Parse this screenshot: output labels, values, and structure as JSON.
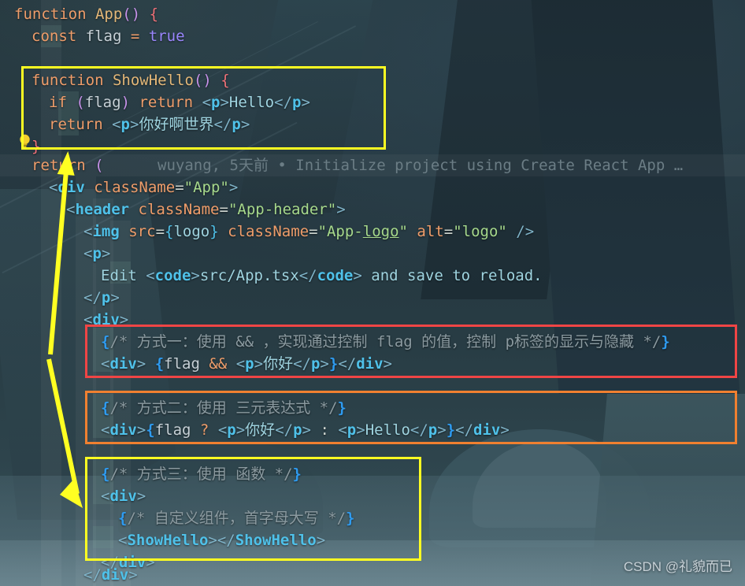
{
  "editor": {
    "theme_background": "#25363f",
    "lines": [
      {
        "id": "l1",
        "indent": 0,
        "text": "function App() {"
      },
      {
        "id": "l2",
        "indent": 1,
        "text": "const flag = true"
      },
      {
        "id": "l3",
        "indent": 1,
        "text": ""
      },
      {
        "id": "l4",
        "indent": 1,
        "text": "function ShowHello() {"
      },
      {
        "id": "l5",
        "indent": 2,
        "text": "if (flag) return <p>Hello</p>"
      },
      {
        "id": "l6",
        "indent": 2,
        "text": "return <p>你好啊世界</p>"
      },
      {
        "id": "l7",
        "indent": 1,
        "text": "}"
      },
      {
        "id": "l8",
        "indent": 1,
        "text": "return ("
      },
      {
        "id": "l9",
        "indent": 2,
        "text": "<div className=\"App\">"
      },
      {
        "id": "l10",
        "indent": 3,
        "text": "<header className=\"App-header\">"
      },
      {
        "id": "l11",
        "indent": 4,
        "text": "<img src={logo} className=\"App-logo\" alt=\"logo\" />"
      },
      {
        "id": "l12",
        "indent": 4,
        "text": "<p>"
      },
      {
        "id": "l13",
        "indent": 5,
        "text": "Edit <code>src/App.tsx</code> and save to reload."
      },
      {
        "id": "l14",
        "indent": 4,
        "text": "</p>"
      },
      {
        "id": "l15",
        "indent": 4,
        "text": "<div>"
      },
      {
        "id": "l16",
        "indent": 5,
        "text": "{/* 方式一：使用 && ，实现通过控制 flag 的值，控制 p标签的显示与隐藏 */}"
      },
      {
        "id": "l17",
        "indent": 5,
        "text": "<div> {flag && <p>你好</p>}</div>"
      },
      {
        "id": "l18",
        "indent": 5,
        "text": "{/* 方式二：使用 三元表达式 */}"
      },
      {
        "id": "l19",
        "indent": 5,
        "text": "<div>{flag ? <p>你好</p> : <p>Hello</p>}</div>"
      },
      {
        "id": "l20",
        "indent": 5,
        "text": "{/* 方式三：使用 函数 */}"
      },
      {
        "id": "l21",
        "indent": 5,
        "text": "<div>"
      },
      {
        "id": "l22",
        "indent": 6,
        "text": "{/* 自定义组件，首字母大写 */}"
      },
      {
        "id": "l23",
        "indent": 6,
        "text": "<ShowHello></ShowHello>"
      },
      {
        "id": "l24",
        "indent": 5,
        "text": "</div>"
      },
      {
        "id": "l25",
        "indent": 4,
        "text": "</div>"
      }
    ],
    "blame_annotation": {
      "author": "wuyang",
      "when": "5天前",
      "separator": "•",
      "message": "Initialize project using Create React App",
      "ellipsis": "…",
      "full": "wuyang, 5天前 • Initialize project using Create React App …"
    },
    "gutter_hint": "intention-bulb"
  },
  "annotations": {
    "boxes": [
      {
        "id": "box-showhello",
        "color": "#ffff22",
        "label": "ShowHello function definition"
      },
      {
        "id": "box-method-one",
        "color": "#f04545",
        "label": "方式一 && 写法"
      },
      {
        "id": "box-method-two",
        "color": "#f08030",
        "label": "方式二 三元表达式"
      },
      {
        "id": "box-method-three",
        "color": "#ffff22",
        "label": "方式三 使用函数"
      }
    ],
    "arrow": {
      "id": "link-arrow",
      "color": "#ffff22",
      "label": "ShowHello definition to usage arrow"
    }
  },
  "watermark": {
    "text": "CSDN @礼貌而已"
  },
  "colors": {
    "keyword": "#ef9d6a",
    "tag": "#4fc1e9",
    "string": "#a7d98c",
    "comment": "#8b9aa0",
    "boolean": "#9a86fd",
    "accent_yellow": "#ffff22",
    "accent_red": "#f04545",
    "accent_orange": "#f08030"
  }
}
